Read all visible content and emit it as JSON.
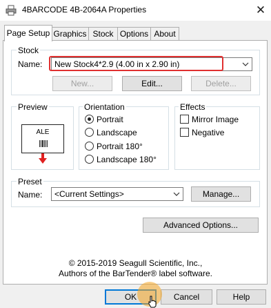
{
  "window": {
    "title": "4BARCODE 4B-2064A Properties"
  },
  "tabs": [
    {
      "label": "Page Setup"
    },
    {
      "label": "Graphics"
    },
    {
      "label": "Stock"
    },
    {
      "label": "Options"
    },
    {
      "label": "About"
    }
  ],
  "stock": {
    "group_label": "Stock",
    "name_label": "Name:",
    "selected": "New Stock4*2.9 (4.00 in x 2.90 in)",
    "new_button": "New...",
    "edit_button": "Edit...",
    "delete_button": "Delete..."
  },
  "preview": {
    "group_label": "Preview",
    "sample_text": "ALE"
  },
  "orientation": {
    "group_label": "Orientation",
    "options": [
      "Portrait",
      "Landscape",
      "Portrait 180°",
      "Landscape 180°"
    ],
    "selected": "Portrait"
  },
  "effects": {
    "group_label": "Effects",
    "mirror_image": "Mirror Image",
    "negative": "Negative"
  },
  "preset": {
    "group_label": "Preset",
    "name_label": "Name:",
    "selected": "<Current Settings>",
    "manage_button": "Manage..."
  },
  "advanced_button": "Advanced Options...",
  "copyright": {
    "line1": "© 2015-2019 Seagull Scientific, Inc.,",
    "line2": "Authors of the BarTender® label software."
  },
  "footer": {
    "ok": "OK",
    "cancel": "Cancel",
    "help": "Help"
  },
  "colors": {
    "highlight": "#e03030",
    "cursor_halo": "#f5a623",
    "preview_arrow": "#e02020",
    "default_button_border": "#0078d7"
  }
}
